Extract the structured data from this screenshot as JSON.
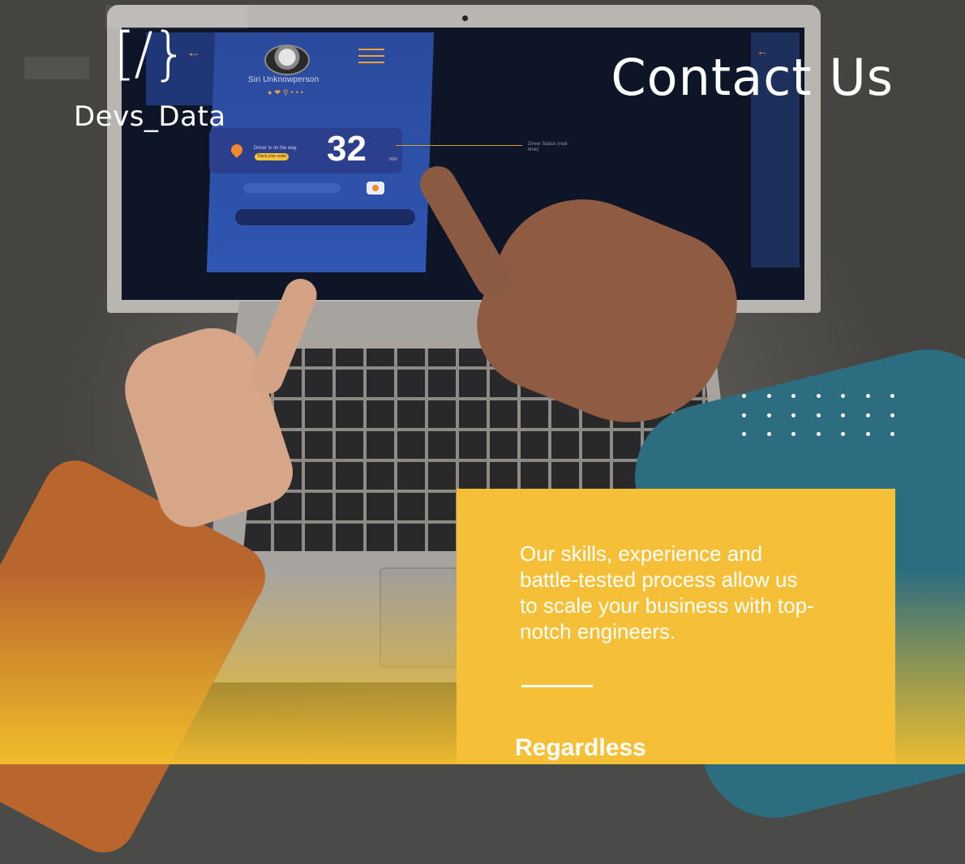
{
  "brand": {
    "logo_mark": "[/}",
    "name": "Devs_Data"
  },
  "header": {
    "title": "Contact Us"
  },
  "screen_app": {
    "user_name": "Siri Unknowperson",
    "icons": [
      "user-icon",
      "heart-icon",
      "search-icon",
      "more-icon"
    ],
    "status_text": "Driver is on the way",
    "track_button": "Track your order",
    "big_number": "32",
    "number_unit": "min",
    "driver_label": "Driver Status (real time)"
  },
  "card": {
    "body": "Our skills, experience and battle-tested process allow us to scale your business with top-notch engineers.",
    "heading": "Regardless"
  },
  "colors": {
    "accent_yellow": "#f5c038",
    "logo_arrow": "#e8995a",
    "text_white": "#ffffff"
  }
}
